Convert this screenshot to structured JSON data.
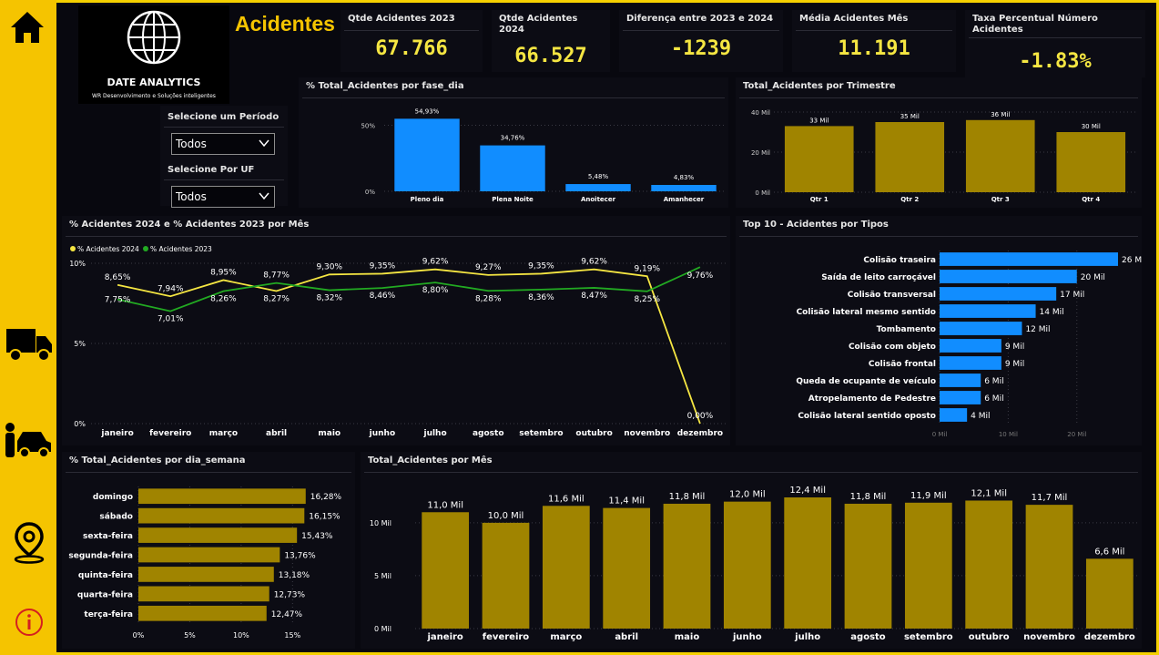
{
  "nav": {
    "items": [
      {
        "icon": "home-icon"
      },
      {
        "icon": "car-crash-icon"
      },
      {
        "icon": "truck-icon"
      },
      {
        "icon": "person-car-icon"
      },
      {
        "icon": "location-pin-icon"
      },
      {
        "icon": "info-icon"
      }
    ]
  },
  "logo": {
    "name": "DATE ANALYTICS",
    "tagline": "WR Desenvolvimento e Soluções inteligentes"
  },
  "header": {
    "title": "Acidentes"
  },
  "filters": {
    "period_label": "Selecione um Período",
    "period_value": "Todos",
    "uf_label": "Selecione Por UF",
    "uf_value": "Todos"
  },
  "kpis": [
    {
      "label": "Qtde Acidentes 2023",
      "value": "67.766"
    },
    {
      "label": "Qtde Acidentes 2024",
      "value": "66.527"
    },
    {
      "label": "Diferença entre 2023 e 2024",
      "value": "-1239"
    },
    {
      "label": "Média Acidentes Mês",
      "value": "11.191"
    },
    {
      "label": "Taxa Percentual Número Acidentes",
      "value": "-1.83%"
    }
  ],
  "colors": {
    "accent": "#f5c400",
    "blue": "#118dff",
    "olive": "#a08400",
    "line2024": "#f5e642",
    "line2023": "#22aa22"
  },
  "chart_data": [
    {
      "id": "fase_dia",
      "type": "bar",
      "title": "% Total_Acidentes por fase_dia",
      "categories": [
        "Pleno dia",
        "Plena Noite",
        "Anoitecer",
        "Amanhecer"
      ],
      "values": [
        54.93,
        34.76,
        5.48,
        4.83
      ],
      "labels": [
        "54,93%",
        "34,76%",
        "5,48%",
        "4,83%"
      ],
      "yticks": [
        "0%",
        "50%"
      ],
      "ylim": [
        0,
        60
      ]
    },
    {
      "id": "trimestre",
      "type": "bar",
      "title": "Total_Acidentes por Trimestre",
      "categories": [
        "Qtr 1",
        "Qtr 2",
        "Qtr 3",
        "Qtr 4"
      ],
      "values": [
        33,
        35,
        36,
        30
      ],
      "labels": [
        "33 Mil",
        "35 Mil",
        "36 Mil",
        "30 Mil"
      ],
      "yticks": [
        "0 Mil",
        "20 Mil",
        "40 Mil"
      ],
      "ylim": [
        0,
        40
      ]
    },
    {
      "id": "mes_pct",
      "type": "line",
      "title": "% Acidentes 2024 e % Acidentes 2023 por Mês",
      "categories": [
        "janeiro",
        "fevereiro",
        "março",
        "abril",
        "maio",
        "junho",
        "julho",
        "agosto",
        "setembro",
        "outubro",
        "novembro",
        "dezembro"
      ],
      "series": [
        {
          "name": "% Acidentes 2024",
          "values": [
            8.65,
            7.94,
            8.95,
            8.27,
            9.3,
            9.35,
            9.62,
            9.27,
            9.35,
            9.62,
            9.19,
            0.0
          ],
          "labels": [
            "8,65%",
            "7,94%",
            "8,95%",
            "8,27%",
            "9,30%",
            "9,35%",
            "9,62%",
            "9,27%",
            "9,35%",
            "9,62%",
            "9,19%",
            "0,00%"
          ]
        },
        {
          "name": "% Acidentes 2023",
          "values": [
            7.75,
            7.01,
            8.26,
            8.77,
            8.32,
            8.46,
            8.8,
            8.28,
            8.36,
            8.47,
            8.25,
            9.76
          ],
          "labels": [
            "7,75%",
            "7,01%",
            "8,26%",
            "8,77%",
            "8,32%",
            "8,46%",
            "8,80%",
            "8,28%",
            "8,36%",
            "8,47%",
            "8,25%",
            "9,76%"
          ]
        }
      ],
      "yticks": [
        "0%",
        "5%",
        "10%"
      ],
      "ylim": [
        0,
        10
      ]
    },
    {
      "id": "tipos",
      "type": "bar",
      "orientation": "horizontal",
      "title": "Top 10 - Acidentes por Tipos",
      "categories": [
        "Colisão traseira",
        "Saída de leito carroçável",
        "Colisão transversal",
        "Colisão lateral mesmo sentido",
        "Tombamento",
        "Colisão com objeto",
        "Colisão frontal",
        "Queda de ocupante de veículo",
        "Atropelamento de Pedestre",
        "Colisão lateral sentido oposto"
      ],
      "values": [
        26,
        20,
        17,
        14,
        12,
        9,
        9,
        6,
        6,
        4
      ],
      "labels": [
        "26 Mil",
        "20 Mil",
        "17 Mil",
        "14 Mil",
        "12 Mil",
        "9 Mil",
        "9 Mil",
        "6 Mil",
        "6 Mil",
        "4 Mil"
      ],
      "xticks": [
        "0 Mil",
        "10 Mil",
        "20 Mil"
      ],
      "xlim": [
        0,
        26
      ]
    },
    {
      "id": "dia_semana",
      "type": "bar",
      "orientation": "horizontal",
      "title": "% Total_Acidentes por dia_semana",
      "categories": [
        "domingo",
        "sábado",
        "sexta-feira",
        "segunda-feira",
        "quinta-feira",
        "quarta-feira",
        "terça-feira"
      ],
      "values": [
        16.28,
        16.15,
        15.43,
        13.76,
        13.18,
        12.73,
        12.47
      ],
      "labels": [
        "16,28%",
        "16,15%",
        "15,43%",
        "13,76%",
        "13,18%",
        "12,73%",
        "12,47%"
      ],
      "xticks": [
        "0%",
        "5%",
        "10%",
        "15%"
      ],
      "xlim": [
        0,
        16.3
      ]
    },
    {
      "id": "mes_total",
      "type": "bar",
      "title": "Total_Acidentes por Mês",
      "categories": [
        "janeiro",
        "fevereiro",
        "março",
        "abril",
        "maio",
        "junho",
        "julho",
        "agosto",
        "setembro",
        "outubro",
        "novembro",
        "dezembro"
      ],
      "values": [
        11.0,
        10.0,
        11.6,
        11.4,
        11.8,
        12.0,
        12.4,
        11.8,
        11.9,
        12.1,
        11.7,
        6.6
      ],
      "labels": [
        "11,0 Mil",
        "10,0 Mil",
        "11,6 Mil",
        "11,4 Mil",
        "11,8 Mil",
        "12,0 Mil",
        "12,4 Mil",
        "11,8 Mil",
        "11,9 Mil",
        "12,1 Mil",
        "11,7 Mil",
        "6,6 Mil"
      ],
      "yticks": [
        "0 Mil",
        "5 Mil",
        "10 Mil"
      ],
      "ylim": [
        0,
        12.4
      ]
    }
  ]
}
